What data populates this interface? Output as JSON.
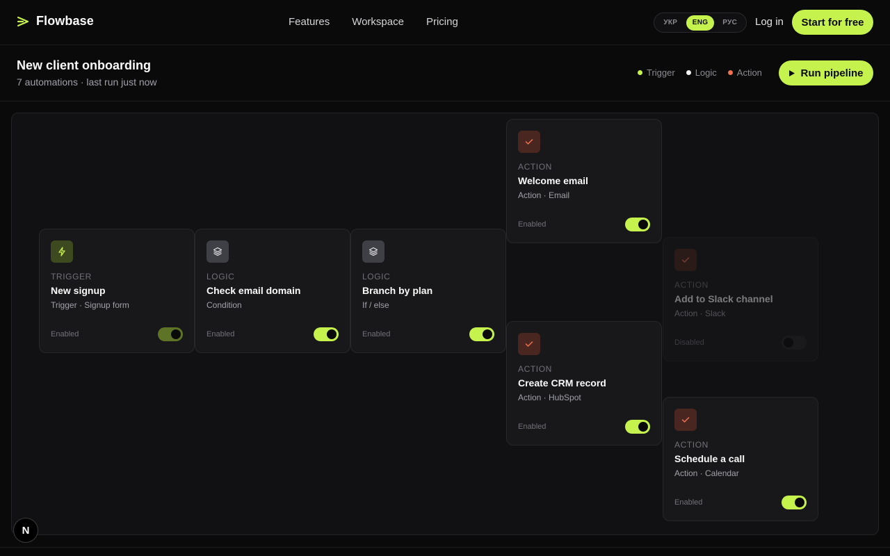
{
  "brand": {
    "name": "Flowbase",
    "icon": "chevron-right-icon"
  },
  "nav": {
    "links": [
      "Features",
      "Workspace",
      "Pricing"
    ]
  },
  "languages": {
    "options": [
      "УКР",
      "ENG",
      "РУС"
    ],
    "selected": "ENG"
  },
  "header_actions": {
    "login": "Log in",
    "start": "Start for free"
  },
  "page": {
    "title": "New client onboarding",
    "subtitle": "7 automations · last run just now",
    "legend": [
      {
        "label": "Trigger",
        "color": "#c6f24e"
      },
      {
        "label": "Logic",
        "color": "#f4f4f5"
      },
      {
        "label": "Action",
        "color": "#f0714f"
      }
    ],
    "run_button": "Run pipeline"
  },
  "nodes": [
    {
      "kind": "trigger",
      "type": "TRIGGER",
      "title": "New signup",
      "subtitle": "Trigger · Signup form",
      "status": "Enabled",
      "enabled": true,
      "icon": "lightning-icon"
    },
    {
      "kind": "logic",
      "type": "LOGIC",
      "title": "Check email domain",
      "subtitle": "Condition",
      "status": "Enabled",
      "enabled": true,
      "icon": "layers-icon"
    },
    {
      "kind": "logic",
      "type": "LOGIC",
      "title": "Branch by plan",
      "subtitle": "If / else",
      "status": "Enabled",
      "enabled": true,
      "icon": "layers-icon"
    },
    {
      "kind": "action",
      "type": "ACTION",
      "title": "Welcome email",
      "subtitle": "Action · Email",
      "status": "Enabled",
      "enabled": true,
      "icon": "check-icon"
    },
    {
      "kind": "action",
      "type": "ACTION",
      "title": "Add to Slack channel",
      "subtitle": "Action · Slack",
      "status": "Disabled",
      "enabled": false,
      "icon": "check-icon"
    },
    {
      "kind": "action",
      "type": "ACTION",
      "title": "Create CRM record",
      "subtitle": "Action · HubSpot",
      "status": "Enabled",
      "enabled": true,
      "icon": "check-icon"
    },
    {
      "kind": "action",
      "type": "ACTION",
      "title": "Schedule a call",
      "subtitle": "Action · Calendar",
      "status": "Enabled",
      "enabled": true,
      "icon": "check-icon"
    }
  ],
  "dev_badge": "N"
}
